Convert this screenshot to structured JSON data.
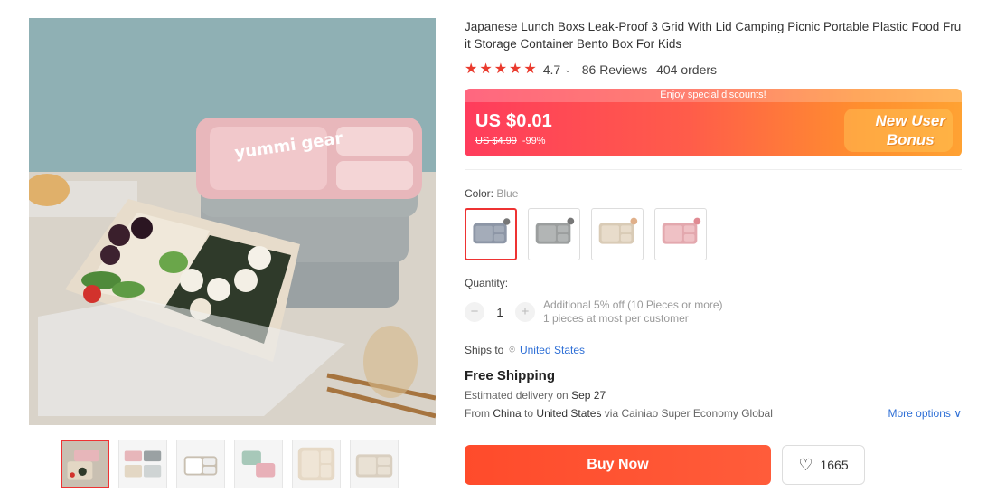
{
  "product": {
    "title": "Japanese Lunch Boxs Leak-Proof 3 Grid With Lid Camping Picnic Portable Plastic Food Fruit Storage Container Bento Box For Kids",
    "image_logo_text": "yummi gear",
    "rating": "4.7",
    "rating_stars": 5,
    "reviews": "86 Reviews",
    "orders": "404 orders"
  },
  "promo": {
    "banner_text": "Enjoy special discounts!",
    "price": "US $0.01",
    "original_price": "US $4.99",
    "discount": "-99%",
    "bonus_line1": "New User",
    "bonus_line2": "Bonus"
  },
  "color": {
    "label": "Color:",
    "selected": "Blue",
    "options": [
      "Blue",
      "Gray",
      "Beige",
      "Pink"
    ]
  },
  "quantity": {
    "label": "Quantity:",
    "value": "1",
    "minus": "−",
    "plus": "+",
    "offer": "Additional 5% off (10 Pieces or more)",
    "limit": "1 pieces at most per customer"
  },
  "shipping": {
    "ships_to_label": "Ships to",
    "country": "United States",
    "free_label": "Free Shipping",
    "eta_prefix": "Estimated delivery on",
    "eta_date": "Sep 27",
    "from_label": "From",
    "from": "China",
    "to_label": "to",
    "to": "United States",
    "via": "via Cainiao Super Economy Global",
    "more_options": "More options ∨"
  },
  "actions": {
    "buy_now": "Buy Now",
    "wishlist_count": "1665"
  },
  "colors": {
    "accent": "#ea3a2d",
    "link": "#2e6fd6",
    "buy": "#ff4b2b"
  }
}
